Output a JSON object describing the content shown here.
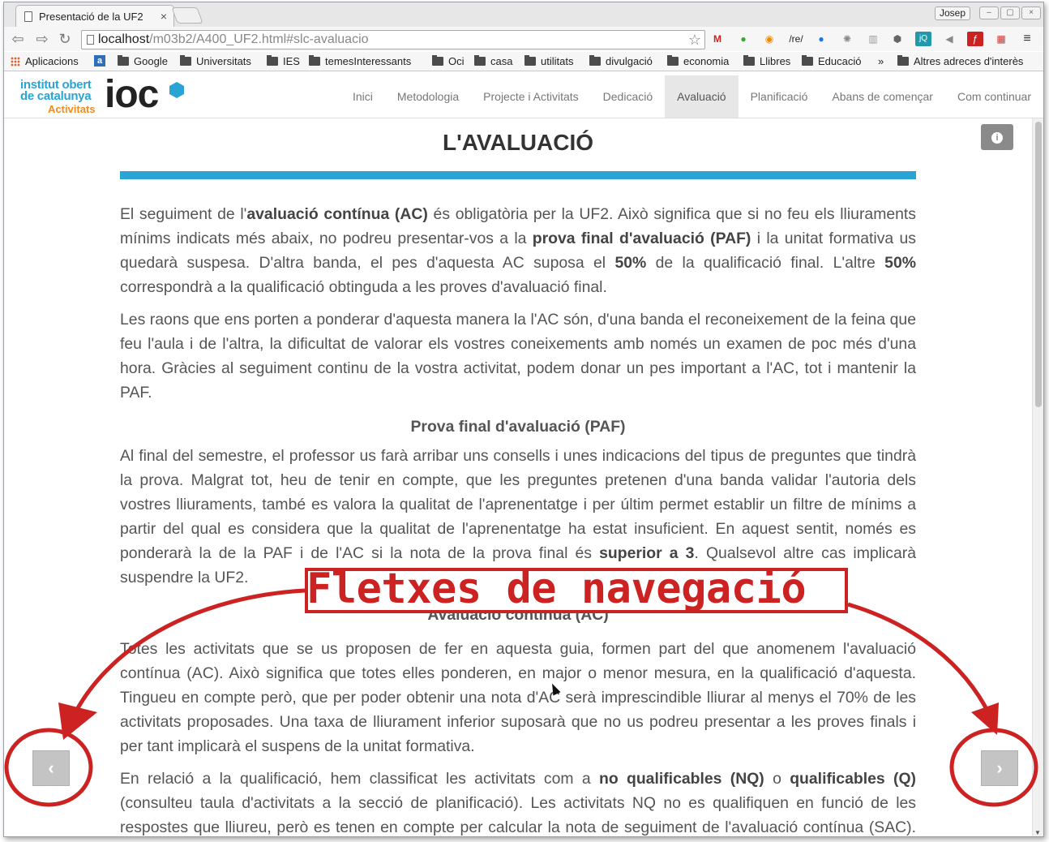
{
  "browser": {
    "tab_title": "Presentació de la UF2",
    "tab_close": "×",
    "profile_name": "Josep",
    "url_host": "localhost",
    "url_path": "/m03b2/A400_UF2.html#slc-avaluacio",
    "bookmarks": [
      "Aplicacions",
      "Google",
      "Universitats",
      "IES",
      "temesInteressants",
      "Oci",
      "casa",
      "utilitats",
      "divulgació",
      "economia",
      "Llibres",
      "Educació"
    ],
    "bookmarks_more": "»",
    "bookmarks_other": "Altres adreces d'interès",
    "ext_re_label": "/re/",
    "ext_jq_label": "jQ"
  },
  "site": {
    "logo_line1": "institut obert",
    "logo_line2": "de catalunya",
    "logo_sub": "Activitats",
    "logo_mark": "ioc",
    "menu": [
      "Inici",
      "Metodologia",
      "Projecte i Activitats",
      "Dedicació",
      "Avaluació",
      "Planificació",
      "Abans de començar",
      "Com continuar"
    ],
    "active_menu": "Avaluació",
    "info_icon": "i"
  },
  "content": {
    "title": "L'AVALUACIÓ",
    "p1": {
      "a": "El seguiment de l'",
      "b": "avaluació contínua (AC)",
      "c": " és obligatòria per la UF2. Això significa que si no feu els lliuraments mínims indicats més abaix, no podreu presentar-vos a la ",
      "d": "prova final d'avaluació (PAF)",
      "e": " i la unitat formativa us quedarà suspesa. D'altra banda, el pes d'aquesta AC suposa el ",
      "f": "50%",
      "g": " de la qualificació final. L'altre ",
      "h": "50%",
      "i": " correspondrà a la qualificació obtinguda a les proves d'avaluació final."
    },
    "p2": "Les raons que ens porten a ponderar d'aquesta manera la l'AC són, d'una banda el reconeixement de la feina que feu l'aula i de l'altra, la dificultat de valorar els vostres coneixements amb només un examen de poc més d'una hora. Gràcies al seguiment continu de la vostra activitat, podem donar un pes important a l'AC, tot i mantenir la PAF.",
    "h_paf": "Prova final d'avaluació (PAF)",
    "p3": {
      "a": "Al final del semestre, el professor us farà arribar uns consells i unes indicacions del tipus de preguntes que tindrà la prova. Malgrat tot, heu de tenir en compte, que les preguntes pretenen d'una banda validar l'autoria dels vostres lliuraments, també es valora la qualitat de l'aprenentatge i per últim permet establir un filtre de mínims a partir del qual es considera que la qualitat de l'aprenentatge ha estat insuficient. En aquest sentit, només es ponderarà la de la PAF i de l'AC si la nota de la prova final és ",
      "b": "superior a 3",
      "c": ". Qualsevol altre cas implicarà suspendre la UF2."
    },
    "h_ac": "Avaluació contínua (AC)",
    "p4": "Totes les activitats que se us proposen de fer en aquesta guia, formen part del que anomenem l'avaluació contínua (AC). Això significa que totes elles ponderen, en major o menor mesura, en la qualificació d'aquesta. Tingueu en compte però, que per poder obtenir una nota d'AC serà imprescindible lliurar al menys el 70% de les activitats proposades. Una taxa de lliurament inferior suposarà que no us podreu presentar a les proves finals i per tant implicarà el suspens de la unitat formativa.",
    "p5": {
      "a": "En relació a la qualificació, hem classificat les activitats com a ",
      "b": "no qualificables (NQ)",
      "c": " o ",
      "d": "qualificables (Q)",
      "e": " (consulteu taula d'activitats a la secció de planificació). Les activitats NQ no es qualifiquen en funció de les respostes que lliureu, però es tenen en compte per calcular la nota de seguiment de l'avaluació contínua (SAC). La nota de seguiment es calcula usant la fórmula següent:"
    }
  },
  "nav": {
    "prev": "‹",
    "next": "›"
  },
  "annotation": {
    "label": "Fletxes de navegació",
    "color": "#cc2222"
  }
}
